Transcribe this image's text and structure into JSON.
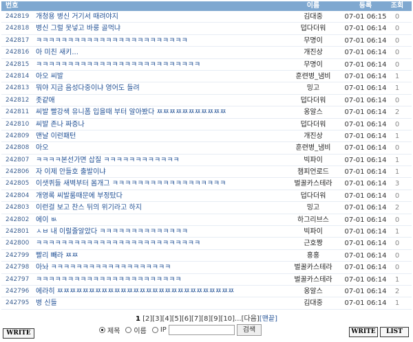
{
  "header": {
    "no": "번호",
    "title": "이름",
    "name": "이름",
    "date": "등록",
    "hit": "조회"
  },
  "rows": [
    {
      "no": "242819",
      "title": "개청용 병신 거기서 때려야지",
      "name": "김대중",
      "date": "07-01 06:15",
      "hit": "0"
    },
    {
      "no": "242818",
      "title": "병신 그럴 못넣고 바룽 골먹냐",
      "name": "덥다더워",
      "date": "07-01 06:14",
      "hit": "0"
    },
    {
      "no": "242817",
      "title": "ㅋㅋㅋㅋㅋㅋㅋㅋㅋㅋㅋㅋㅋㅋㅋㅋㅋㅋㅋㅋㅋㅋㅋㅋ",
      "name": "무명이",
      "date": "07-01 06:14",
      "hit": "0"
    },
    {
      "no": "242816",
      "title": "아 미친 새키...",
      "name": "개진상",
      "date": "07-01 06:14",
      "hit": "0"
    },
    {
      "no": "242815",
      "title": "ㅋㅋㅋㅋㅋㅋㅋㅋㅋㅋㅋㅋㅋㅋㅋㅋㅋㅋㅋㅋㅋㅋㅋㅋㅋㅋ",
      "name": "무명이",
      "date": "07-01 06:14",
      "hit": "0"
    },
    {
      "no": "242814",
      "title": "아오 씨발",
      "name": "훈련병_냄비",
      "date": "07-01 06:14",
      "hit": "1"
    },
    {
      "no": "242813",
      "title": "뭐야 지금 음성다중이냐 영어도 들려",
      "name": "밍고",
      "date": "07-01 06:14",
      "hit": "1"
    },
    {
      "no": "242812",
      "title": "좃같애",
      "name": "덥다더워",
      "date": "07-01 06:14",
      "hit": "0"
    },
    {
      "no": "242811",
      "title": "씨발 빨강색 유니폼 입을때 부터 알아봤다 ㅉㅉㅉㅉㅉㅉㅉㅉㅉㅉㅉ",
      "name": "옹알스",
      "date": "07-01 06:14",
      "hit": "2"
    },
    {
      "no": "242810",
      "title": "씨발 존나 짜증나",
      "name": "덥다더워",
      "date": "07-01 06:14",
      "hit": "0"
    },
    {
      "no": "242809",
      "title": "맨날 이런패턴",
      "name": "개진상",
      "date": "07-01 06:14",
      "hit": "1"
    },
    {
      "no": "242808",
      "title": "아오",
      "name": "훈련병_냄비",
      "date": "07-01 06:14",
      "hit": "0"
    },
    {
      "no": "242807",
      "title": "ㅋㅋㅋㅋ본선가면 삽질 ㅋㅋㅋㅋㅋㅋㅋㅋㅋㅋㅋㅋ",
      "name": "빅파이",
      "date": "07-01 06:14",
      "hit": "1"
    },
    {
      "no": "242806",
      "title": "자 이제 안들호 출발이냐",
      "name": "챔피언로드",
      "date": "07-01 06:14",
      "hit": "1"
    },
    {
      "no": "242805",
      "title": "이샛퀴들 새벽부터 몸개그 ㅋㅋㅋㅋㅋㅋㅋㅋㅋㅋㅋㅋㅋㅋㅋㅋㅋㅋ",
      "name": "벌꿀카스테라",
      "date": "07-01 06:14",
      "hit": "3"
    },
    {
      "no": "242804",
      "title": "개영록 씨발룸때문에 부정탔다",
      "name": "덥다더워",
      "date": "07-01 06:14",
      "hit": "0"
    },
    {
      "no": "242803",
      "title": "이런걸 보고 찬스 뒤의 위기라고 하지",
      "name": "밍고",
      "date": "07-01 06:14",
      "hit": "2"
    },
    {
      "no": "242802",
      "title": "에이 ㅄ",
      "name": "하그리브스",
      "date": "07-01 06:14",
      "hit": "0"
    },
    {
      "no": "242801",
      "title": "ㅅㅂ 내 이럴줄알았다 ㅋㅋㅋㅋㅋㅋㅋㅋㅋㅋㅋㅋㅋㅋ",
      "name": "빅파이",
      "date": "07-01 06:14",
      "hit": "1"
    },
    {
      "no": "242800",
      "title": "ㅋㅋㅋㅋㅋㅋㅋㅋㅋㅋㅋㅋㅋㅋㅋㅋㅋㅋㅋㅋㅋㅋㅋㅋㅋㅋ",
      "name": "근호짱",
      "date": "07-01 06:14",
      "hit": "0"
    },
    {
      "no": "242799",
      "title": "빨리 빼라 ㅉㅉ",
      "name": "홍홍",
      "date": "07-01 06:14",
      "hit": "0"
    },
    {
      "no": "242798",
      "title": "아놔 ㅋㅋㅋㅋㅋㅋㅋㅋㅋㅋㅋㅋㅋㅋㅋㅋㅋㅋㅋ",
      "name": "벌꿀카스테라",
      "date": "07-01 06:14",
      "hit": "0"
    },
    {
      "no": "242797",
      "title": "ㅋㅋㅋㅋㅋㅋㅋㅋㅋㅋㅋㅋㅋㅋㅋㅋㅋㅋㅋㅋㅋㅋㅋ",
      "name": "벌꿀카스테라",
      "date": "07-01 06:14",
      "hit": "1"
    },
    {
      "no": "242796",
      "title": "에라히 ㅉㅉㅉㅉㅉㅉㅉㅉㅉㅉㅉㅉㅉㅉㅉㅉㅉㅉㅉㅉㅉㅉㅉㅉㅉㅉㅉㅉ",
      "name": "옹알스",
      "date": "07-01 06:14",
      "hit": "2"
    },
    {
      "no": "242795",
      "title": "병 신들",
      "name": "김대중",
      "date": "07-01 06:14",
      "hit": "1"
    }
  ],
  "pager": {
    "current": "1",
    "pages": [
      "[2]",
      "[3]",
      "[4]",
      "[5]",
      "[6]",
      "[7]",
      "[8]",
      "[9]",
      "[10]"
    ],
    "ellipsis": "...",
    "next": "[다음]",
    "last": "[맨끝]"
  },
  "buttons": {
    "write_left": "WRITE",
    "write_right": "WRITE",
    "list": "LIST"
  },
  "search": {
    "opt_title": "제목",
    "opt_name": "이름",
    "opt_ip": "IP",
    "button": "검색",
    "value": ""
  },
  "colors": {
    "header_bg": "#7FA8D0",
    "title_link": "#1f4f94"
  }
}
